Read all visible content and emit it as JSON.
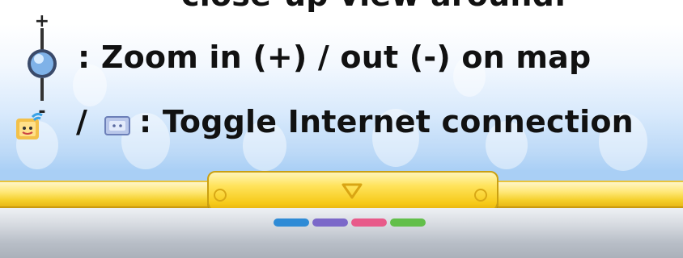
{
  "help_text": {
    "top_line": "close-up view around.",
    "zoom_line": ": Zoom in (+) / out (-) on map",
    "net_separator": "/",
    "net_line": ": Toggle Internet connection"
  },
  "zoom_icon": {
    "plus": "+",
    "minus": "-"
  },
  "icons": {
    "zoom_control": "circle-pad-slider-icon",
    "camera_online": "online-mii-icon",
    "offline_screen": "offline-screen-icon",
    "toggle_arrow": "triangle-down-icon"
  },
  "page_indicator": {
    "colors": [
      "#2e8bd6",
      "#7b68c9",
      "#e85a8a",
      "#62bf4a"
    ]
  },
  "colors": {
    "gold_bar": "#f4cf2a",
    "silver_bar": "#c6ccd3",
    "background_sky": "#a9cff5"
  }
}
